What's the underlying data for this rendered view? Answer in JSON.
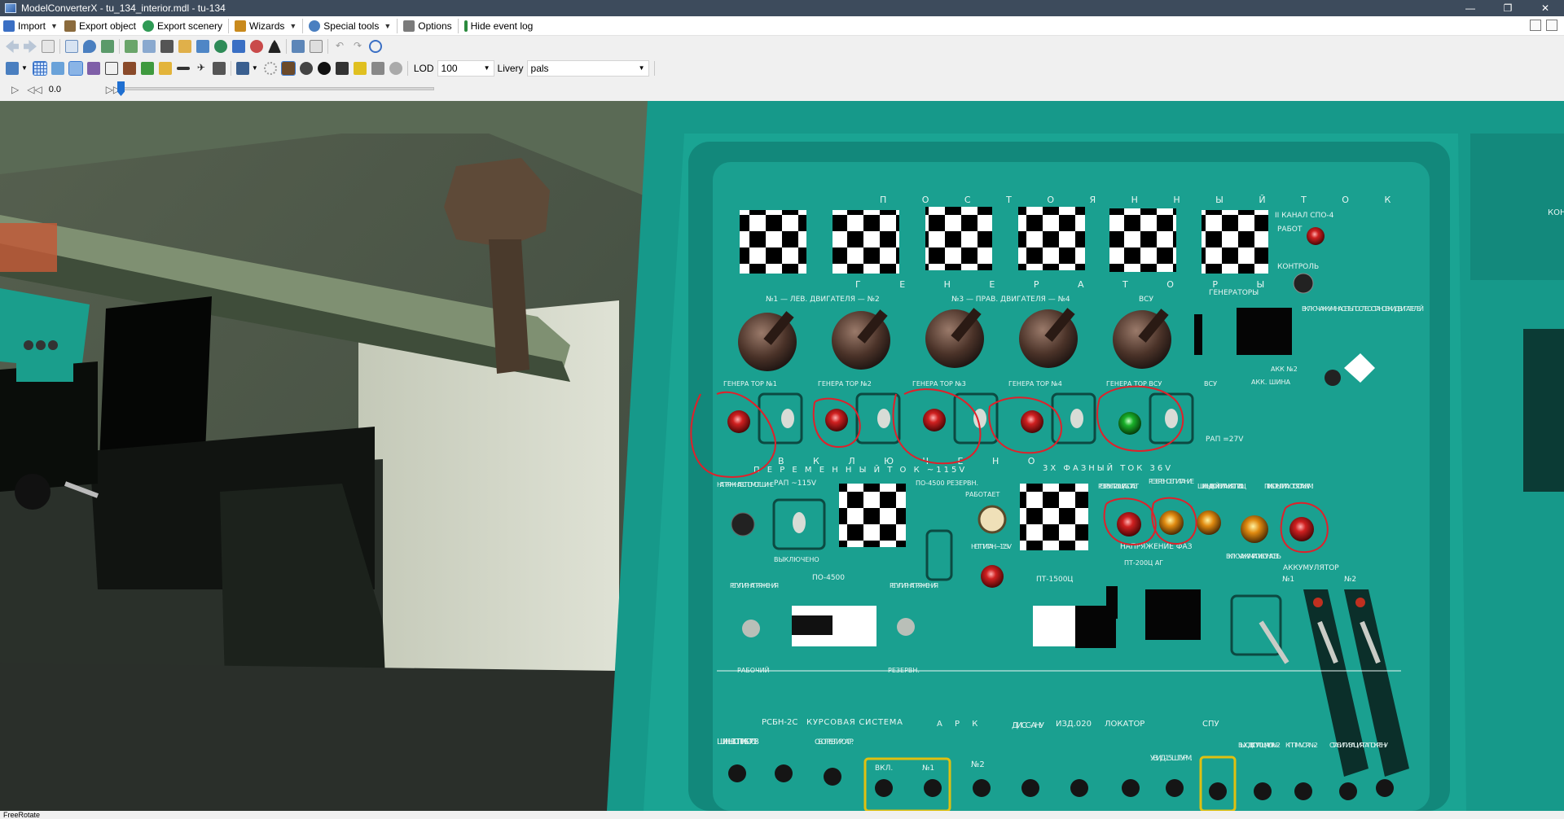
{
  "window": {
    "title": "ModelConverterX - tu_134_interior.mdl - tu-134"
  },
  "menu": {
    "import": "Import",
    "export_object": "Export object",
    "export_scenery": "Export scenery",
    "wizards": "Wizards",
    "special_tools": "Special tools",
    "options": "Options",
    "hide_event_log": "Hide event log"
  },
  "toolbar": {
    "lod_label": "LOD",
    "lod_value": "100",
    "livery_label": "Livery",
    "livery_value": "pals"
  },
  "animation": {
    "time": "0.0",
    "progress": 0
  },
  "panel": {
    "header_dc": "П О С Т О Я Н Н Ы Й   Т О К",
    "generators": "Г Е Н Е Р А Т О Р Ы",
    "engines_left": "№1 — ЛЕВ. ДВИГАТЕЛЯ — №2",
    "engines_right": "№3 — ПРАВ. ДВИГАТЕЛЯ — №4",
    "vsu": "ВСУ",
    "spo_channel": "II КАНАЛ СПО-4",
    "work": "РАБОТ",
    "control": "КОНТРОЛЬ",
    "generators_sel": "ГЕНЕРАТОРЫ",
    "accum_connect": "ВКЛЮЧ. АККУМ. НА СЕТЬ ПОСЛЕ ОСТАНОВКИ ДВИГАТЕЛЕЙ",
    "akk_bus": "АКК. ШИНА",
    "akk_n2": "АКК №2",
    "gen_on": "В К Л Ю Ч Е Н О",
    "ac_header": "П Е Р Е М Е Н Н Ы Й   Т О К ~115V",
    "ac3_header": "3Х ФАЗНЫЙ ТОК 36V",
    "rap_27": "РАП =27V",
    "rap_115": "РАП ~115V",
    "voltage_aux": "НАПРЯЖ. НА ВСПОМОГ. ШИНЕ",
    "off": "ВЫКЛЮЧЕНО",
    "po4500_reserve": "ПО-4500 РЕЗЕРВН.",
    "works": "РАБОТАЕТ",
    "no_power": "НЕТ ПИТАН. ~115V",
    "reserve_pt": "РЕЗЕРВН. ПТ-200Ц РАБОТАЕТ",
    "reserve_power": "РЕЗЕРВНОЕ ПИТАНИЕ",
    "bus_dual": "ШИНЫ ДВОЙН. ПИТАНИЯ ОТ ПТ-200Ц",
    "devices_akk": "ПРИБОРЫ ПИТАЮТСЯ ОТ АККУМ.",
    "phase_voltage": "НАПРЯЖЕНИЕ ФАЗ",
    "accum": "АККУМУЛЯТОР",
    "n1": "№1",
    "n2": "№2",
    "reg_left": "РЕГУЛИР. НАПРЯЖЕНИЯ",
    "po4500": "ПО-4500",
    "reg_right": "РЕГУЛИР. НАПРЯЖЕНИЯ",
    "working": "РАБОЧИЙ",
    "reserve": "РЕЗЕРВН.",
    "pt1500": "ПТ-1500Ц",
    "pt200": "ПТ-200Ц АГ",
    "incl_akk": "ВКЛЮЧ. АККУМ. РАП И ВСУ НА СЕТЬ",
    "bottom": [
      "ШИНЫ ВОТ ПРИБОРОВ",
      "РСБН-2С",
      "КУРСОВАЯ СИСТЕМА",
      "А Р К",
      "ДИСС-АНУ",
      "ИЗД.020",
      "ЛОКАТОР",
      "СПУ",
      "ВЫХОД В СПУ ЛОЦМ VOR №2",
      "КПП-М VOR №2",
      "СТАБИЛИЗАЦИЯ ГА ПО КРЕНУ"
    ],
    "obogrev": "ОБОГРЕВ ГИРОАГР.",
    "vkl": "ВКЛ.",
    "uvid": "УВИД-15 ШТУРМ.",
    "gen_labels": [
      "ГЕНЕРА ТОР №1",
      "ГЕНЕРА ТОР №2",
      "ГЕНЕРА ТОР №3",
      "ГЕНЕРА ТОР №4",
      "ГЕНЕРА ТОР ВСУ"
    ],
    "bsu": "ВСУ",
    "side_text": "КОНТ АН"
  },
  "status": {
    "text": "FreeRotate"
  },
  "colors": {
    "panel_teal": "#1a9e8c",
    "annotation_red": "#e0202a",
    "titlebar": "#3d4b5c"
  }
}
